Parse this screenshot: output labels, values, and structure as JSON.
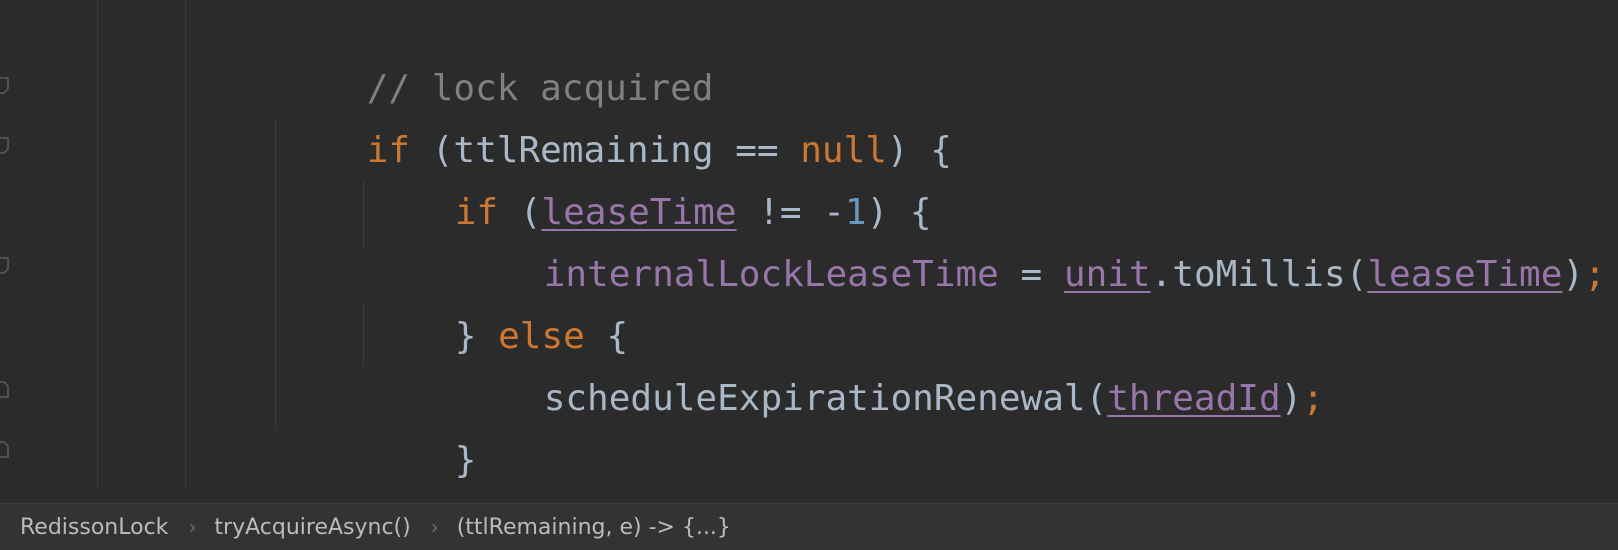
{
  "editor": {
    "lines": {
      "l1": {
        "comment": "// lock acquired"
      },
      "l2": {
        "kw_if": "if",
        "open_paren": " (",
        "var": "ttlRemaining",
        "op": " == ",
        "kw_null": "null",
        "close": ") {"
      },
      "l3": {
        "kw_if": "if",
        "open_paren": " (",
        "var": "leaseTime",
        "op": " != -",
        "num": "1",
        "close": ") {"
      },
      "l4": {
        "field": "internalLockLeaseTime",
        "op": " = ",
        "unit": "unit",
        "method": ".toMillis(",
        "arg": "leaseTime",
        "close": ")",
        "semi": ";"
      },
      "l5": {
        "brace": "} ",
        "kw_else": "else",
        "open": " {"
      },
      "l6": {
        "method": "scheduleExpirationRenewal(",
        "arg": "threadId",
        "close": ")",
        "semi": ";"
      },
      "l7": {
        "brace": "}"
      },
      "l8": {
        "brace": "}"
      }
    }
  },
  "breadcrumbs": {
    "items": [
      "RedissonLock",
      "tryAcquireAsync()",
      "(ttlRemaining, e) -> {...}"
    ],
    "separator": "›"
  },
  "colors": {
    "background": "#2b2b2b",
    "keyword": "#cc7832",
    "comment": "#808080",
    "number": "#6897bb",
    "field": "#9876aa",
    "default": "#a9b7c6"
  }
}
